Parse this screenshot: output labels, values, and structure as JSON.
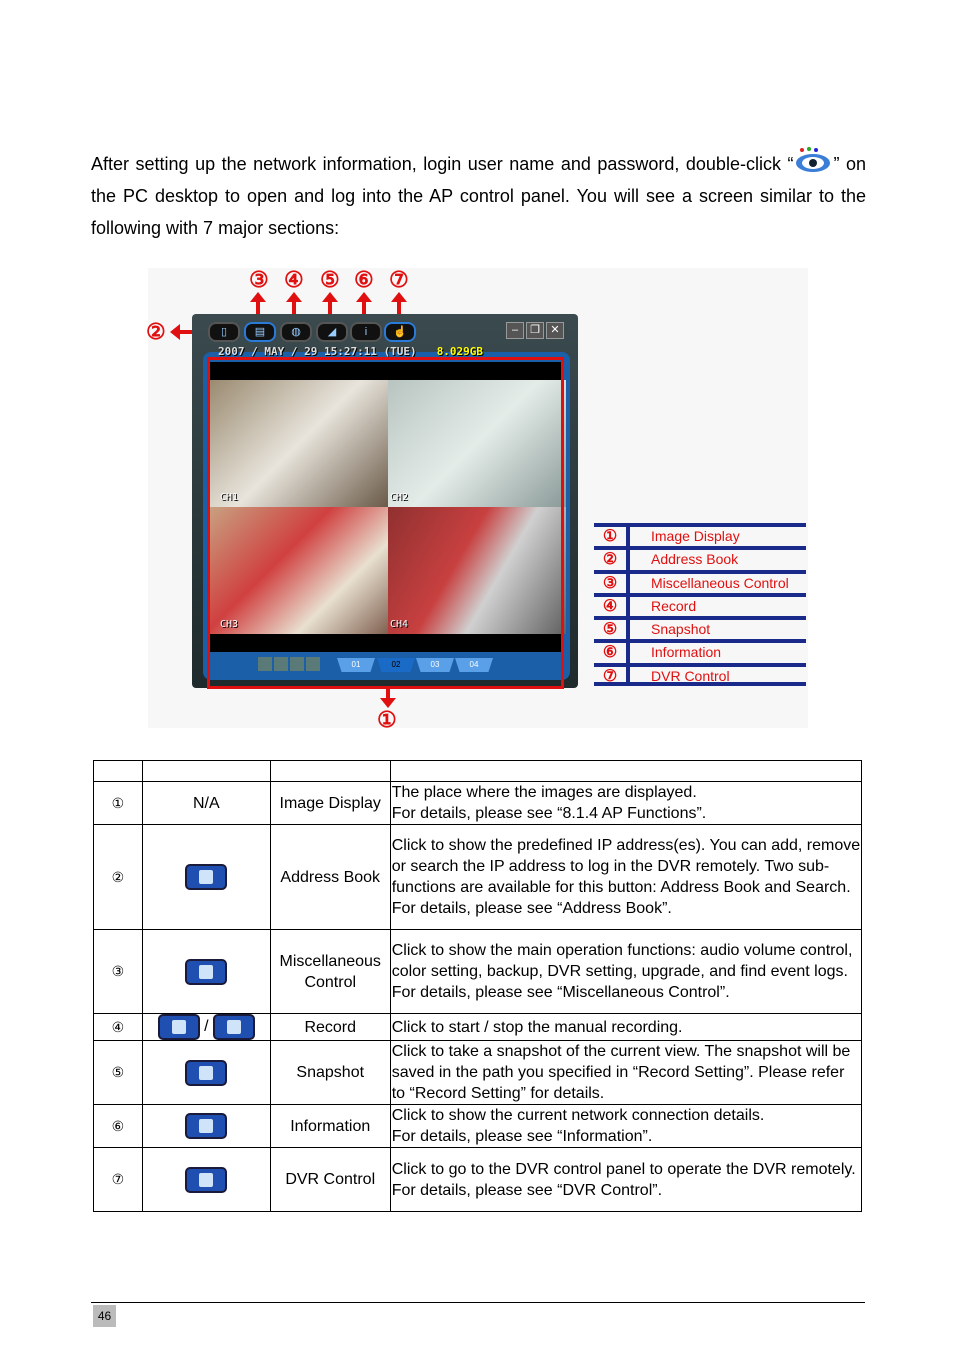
{
  "intro": {
    "part1": "After setting up the network information, login user name and password, double-click “",
    "part2": "” on the PC desktop to open and log into the AP control panel. You will see a screen similar to the following with 7 major sections:",
    "icon": "ap-desktop-eye-icon"
  },
  "figure": {
    "callouts": [
      "①",
      "②",
      "③",
      "④",
      "⑤",
      "⑥",
      "⑦"
    ],
    "osd": {
      "datetime": "2007 / MAY / 29 15:27:11 (TUE)",
      "disk": "8.029GB"
    },
    "channels": [
      "CH1",
      "CH2",
      "CH3",
      "CH4"
    ],
    "pages": [
      "01",
      "02",
      "03",
      "04"
    ],
    "selected_page": "02",
    "window_controls": {
      "minimize": "–",
      "restore": "❐",
      "close": "✕"
    },
    "legend": [
      {
        "num": "①",
        "label": "Image Display"
      },
      {
        "num": "②",
        "label": "Address Book"
      },
      {
        "num": "③",
        "label": "Miscellaneous Control"
      },
      {
        "num": "④",
        "label": "Record"
      },
      {
        "num": "⑤",
        "label": "Snapshot"
      },
      {
        "num": "⑥",
        "label": "Information"
      },
      {
        "num": "⑦",
        "label": "DVR Control"
      }
    ],
    "colors": {
      "callout": "#e01010",
      "legend_border": "#1a2a8a",
      "window_blue": "#1a5fa8"
    }
  },
  "table": {
    "header": [
      "",
      "",
      "",
      ""
    ],
    "rows": [
      {
        "num": "①",
        "icon": "N/A",
        "function": "Image Display",
        "desc": [
          "The place where the images are displayed.",
          "For details, please see “8.1.4 AP Functions”."
        ]
      },
      {
        "num": "②",
        "icon": "address-book-icon",
        "function": "Address Book",
        "desc": [
          "Click to show the predefined IP address(es). You can add, remove or search the IP address to log in the DVR remotely. Two sub-functions are available for this button: Address Book and Search.",
          "For details, please see “Address Book”."
        ]
      },
      {
        "num": "③",
        "icon": "misc-control-icon",
        "function": "Miscellaneous Control",
        "desc": [
          "Click to show the main operation functions: audio volume control, color setting, backup, DVR setting, upgrade, and find event logs.",
          "For details, please see “Miscellaneous Control”."
        ]
      },
      {
        "num": "④",
        "icon": "record-icon",
        "sep": "/",
        "function": "Record",
        "desc": [
          "Click to start / stop the manual recording."
        ]
      },
      {
        "num": "⑤",
        "icon": "snapshot-icon",
        "function": "Snapshot",
        "desc": [
          "Click to take a snapshot of the current view. The snapshot will be saved in the path you specified in “Record Setting”. Please refer to “Record Setting” for details."
        ]
      },
      {
        "num": "⑥",
        "icon": "information-icon",
        "function": "Information",
        "desc": [
          "Click to show the current network connection details.",
          "For details, please see “Information”."
        ]
      },
      {
        "num": "⑦",
        "icon": "dvr-control-icon",
        "function": "DVR Control",
        "desc": [
          "Click to go to the DVR control panel to operate the DVR remotely.",
          "For details, please see “DVR Control”."
        ]
      }
    ]
  },
  "footer": {
    "page": "46"
  }
}
